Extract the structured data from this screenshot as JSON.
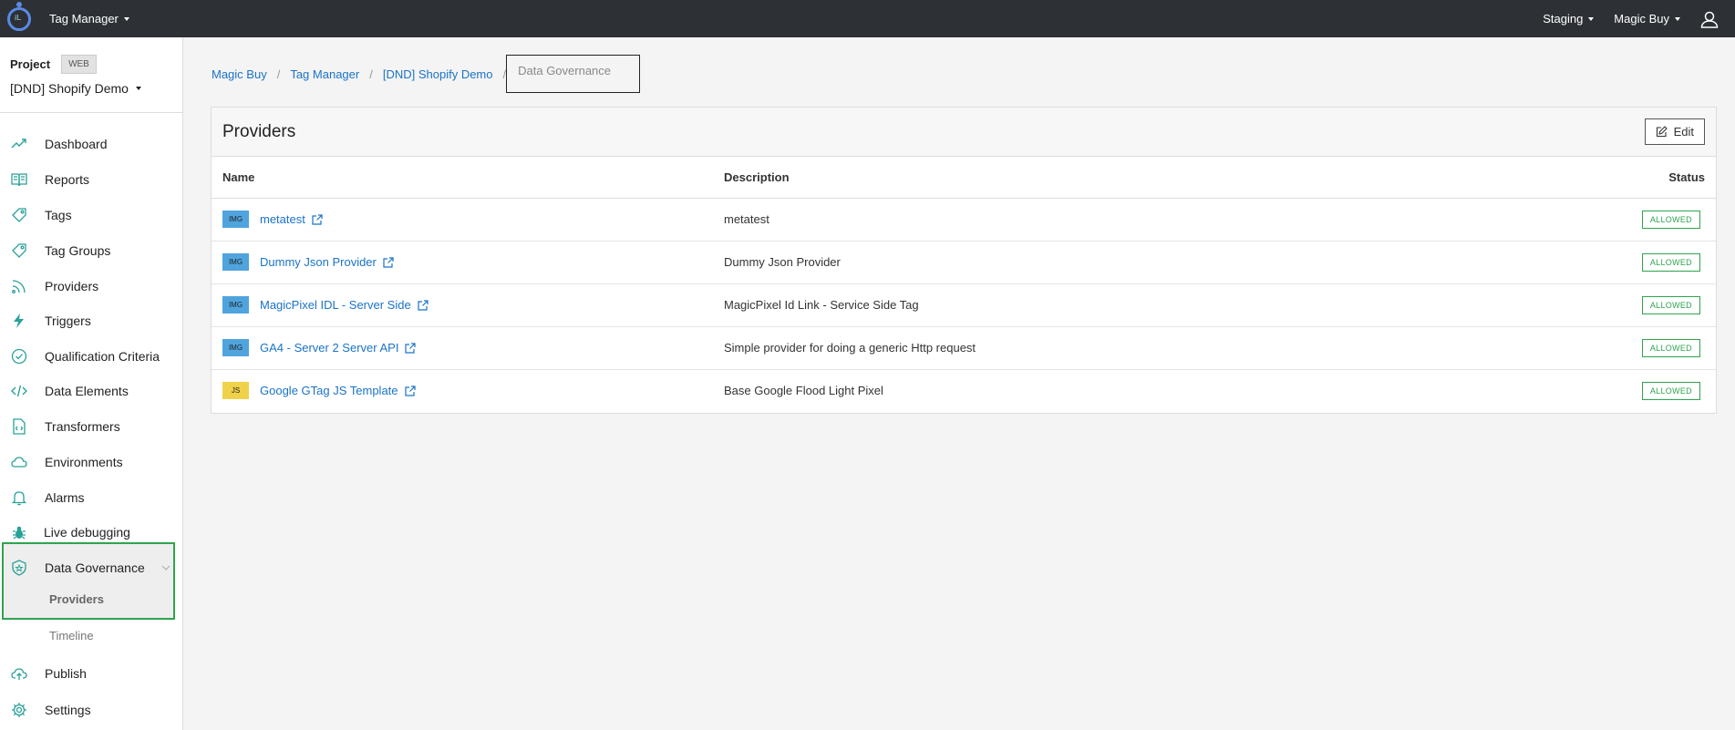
{
  "topbar": {
    "app_name": "Tag Manager",
    "environment": "Staging",
    "organization": "Magic Buy"
  },
  "sidebar": {
    "project_label": "Project",
    "project_type": "WEB",
    "project_name": "[DND] Shopify Demo",
    "items": [
      {
        "label": "Dashboard",
        "icon": "chart-line-icon"
      },
      {
        "label": "Reports",
        "icon": "book-icon"
      },
      {
        "label": "Tags",
        "icon": "tag-icon"
      },
      {
        "label": "Tag Groups",
        "icon": "tag-icon"
      },
      {
        "label": "Providers",
        "icon": "rss-icon"
      },
      {
        "label": "Triggers",
        "icon": "bolt-icon"
      },
      {
        "label": "Qualification Criteria",
        "icon": "check-circle-icon"
      },
      {
        "label": "Data Elements",
        "icon": "code-icon"
      },
      {
        "label": "Transformers",
        "icon": "file-code-icon"
      },
      {
        "label": "Environments",
        "icon": "cloud-icon"
      },
      {
        "label": "Alarms",
        "icon": "bell-icon"
      },
      {
        "label": "Live debugging",
        "icon": "bug-icon"
      },
      {
        "label": "Data Governance",
        "icon": "shield-icon"
      }
    ],
    "sub_items": [
      {
        "label": "Providers",
        "active": true
      },
      {
        "label": "Timeline",
        "active": false
      }
    ],
    "bottom_items": [
      {
        "label": "Publish",
        "icon": "cloud-upload-icon"
      },
      {
        "label": "Settings",
        "icon": "gear-icon"
      }
    ]
  },
  "breadcrumb": [
    "Magic Buy",
    "Tag Manager",
    "[DND] Shopify Demo",
    "Data Governance"
  ],
  "panel": {
    "title": "Providers",
    "edit_label": "Edit",
    "columns": {
      "name": "Name",
      "description": "Description",
      "status": "Status"
    },
    "rows": [
      {
        "type": "IMG",
        "name": "metatest",
        "description": "metatest",
        "status": "ALLOWED"
      },
      {
        "type": "IMG",
        "name": "Dummy Json Provider",
        "description": "Dummy Json Provider",
        "status": "ALLOWED"
      },
      {
        "type": "IMG",
        "name": "MagicPixel IDL - Server Side",
        "description": "MagicPixel Id Link - Service Side Tag",
        "status": "ALLOWED"
      },
      {
        "type": "IMG",
        "name": "GA4 - Server 2 Server API",
        "description": "Simple provider for doing a generic Http request",
        "status": "ALLOWED"
      },
      {
        "type": "JS",
        "name": "Google GTag JS Template",
        "description": "Base Google Flood Light Pixel",
        "status": "ALLOWED"
      }
    ]
  },
  "colors": {
    "accent": "#1a73c9",
    "allowed": "#2da44e",
    "topbar": "#2d3135",
    "sidebar_icon": "#2aa198"
  }
}
